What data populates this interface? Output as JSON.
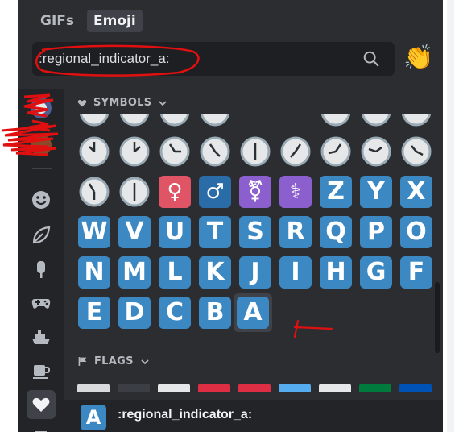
{
  "tabs": {
    "gifs_label": "GIFs",
    "emoji_label": "Emoji"
  },
  "search": {
    "value": ":regional_indicator_a:",
    "icon": "search-icon"
  },
  "skin_tone_button": {
    "emoji": "👏"
  },
  "rail": {
    "items": [
      {
        "icon": "smiley-face-icon"
      },
      {
        "icon": "leaf-icon"
      },
      {
        "icon": "ice-pop-icon"
      },
      {
        "icon": "gamepad-icon"
      },
      {
        "icon": "ship-icon"
      },
      {
        "icon": "coffee-cup-icon"
      },
      {
        "icon": "heart-icon",
        "active": true
      }
    ]
  },
  "sections": {
    "symbols": {
      "label": "SYMBOLS",
      "icon": "heart-icon"
    },
    "flags": {
      "label": "FLAGS",
      "icon": "flag-icon"
    }
  },
  "grid": {
    "row_symbols": [
      "♀",
      "♂",
      "⚧",
      "⚕"
    ],
    "row1_letters": [
      "Z",
      "Y",
      "X"
    ],
    "row2_letters": [
      "W",
      "V",
      "U",
      "T",
      "S",
      "R",
      "Q",
      "P",
      "O"
    ],
    "row3_letters": [
      "N",
      "M",
      "L",
      "K",
      "J",
      "I",
      "H",
      "G",
      "F"
    ],
    "row4_letters": [
      "E",
      "D",
      "C",
      "B",
      "A"
    ],
    "selected": "A"
  },
  "footer": {
    "preview_letter": "A",
    "preview_name": ":regional_indicator_a:"
  },
  "colors": {
    "panel": "#2b2d31",
    "tile_blue": "#3b88c3",
    "annotation_red": "#e01010"
  }
}
